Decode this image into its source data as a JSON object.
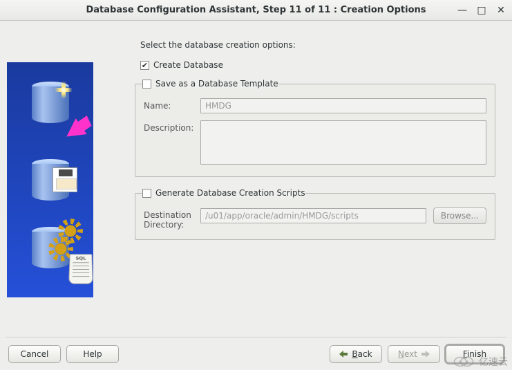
{
  "window": {
    "title": "Database Configuration Assistant, Step 11 of 11 : Creation Options"
  },
  "instruction": "Select the database creation options:",
  "createDatabase": {
    "label": "Create Database",
    "checked": true
  },
  "saveTemplate": {
    "legend": "Save as a Database Template",
    "checked": false,
    "nameLabel": "Name:",
    "nameValue": "HMDG",
    "descLabel": "Description:",
    "descValue": ""
  },
  "generateScripts": {
    "legend": "Generate Database Creation Scripts",
    "checked": false,
    "dirLabel": "Destination Directory:",
    "dirValue": "/u01/app/oracle/admin/HMDG/scripts",
    "browse": "Browse..."
  },
  "buttons": {
    "cancel": "Cancel",
    "help": "Help",
    "back": "Back",
    "next": "Next",
    "finish": "Finish"
  },
  "watermark": "亿速云"
}
